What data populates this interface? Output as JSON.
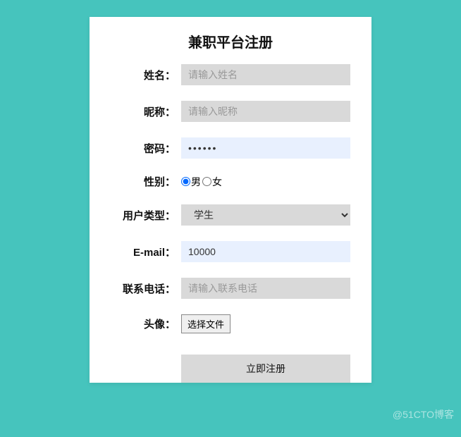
{
  "form": {
    "title": "兼职平台注册",
    "fields": {
      "name": {
        "label": "姓名：",
        "placeholder": "请输入姓名",
        "value": ""
      },
      "nickname": {
        "label": "昵称：",
        "placeholder": "请输入昵称",
        "value": ""
      },
      "password": {
        "label": "密码：",
        "value": "••••••"
      },
      "gender": {
        "label": "性别：",
        "option_male": "男",
        "option_female": "女",
        "selected": "male"
      },
      "usertype": {
        "label": "用户类型：",
        "selected": "学生"
      },
      "email": {
        "label": "E-mail：",
        "value": "10000"
      },
      "phone": {
        "label": "联系电话：",
        "placeholder": "请输入联系电话",
        "value": ""
      },
      "avatar": {
        "label": "头像：",
        "button": "选择文件"
      }
    },
    "submit": "立即注册"
  },
  "watermark": "@51CTO博客"
}
